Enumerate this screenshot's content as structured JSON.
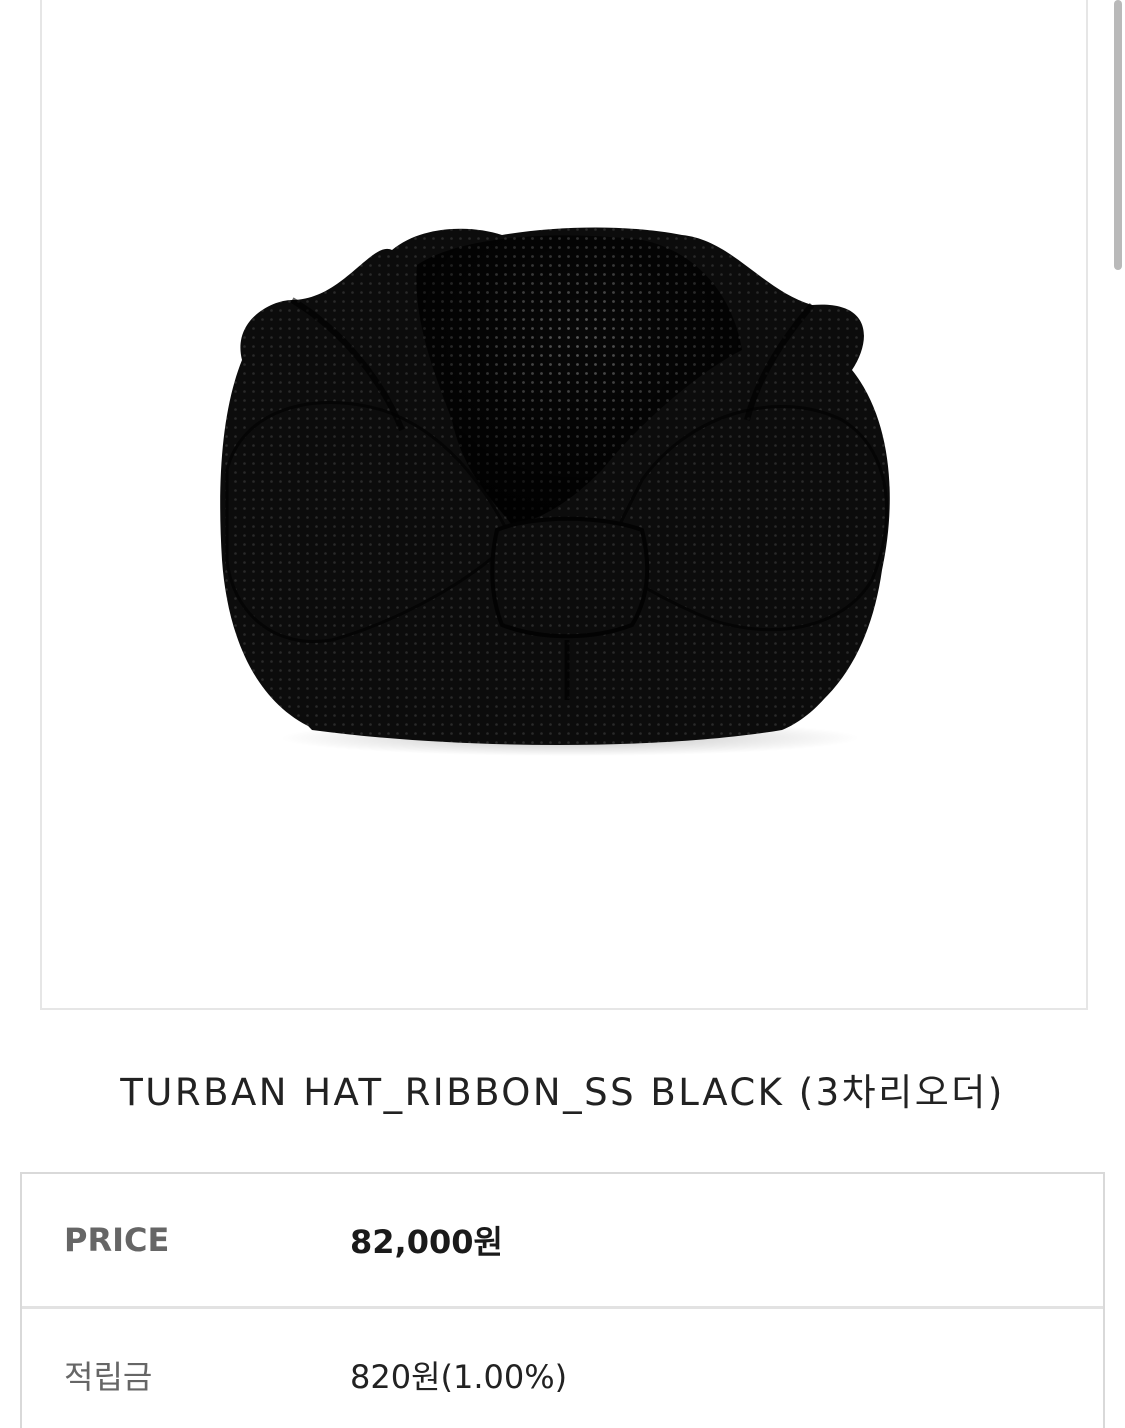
{
  "product": {
    "image_alt": "turban-hat-ribbon-black-photo",
    "title": "TURBAN HAT_RIBBON_SS BLACK (3차리오더)"
  },
  "info_table": {
    "rows": [
      {
        "label": "PRICE",
        "value": "82,000원"
      },
      {
        "label": "적립금",
        "value": "820원(1.00%)"
      }
    ]
  },
  "colors": {
    "frame_border": "#e6e6e6",
    "table_border": "#d9d9d9",
    "label_text": "#666666",
    "value_text": "#222222",
    "scrollbar": "#b9b9b9"
  }
}
